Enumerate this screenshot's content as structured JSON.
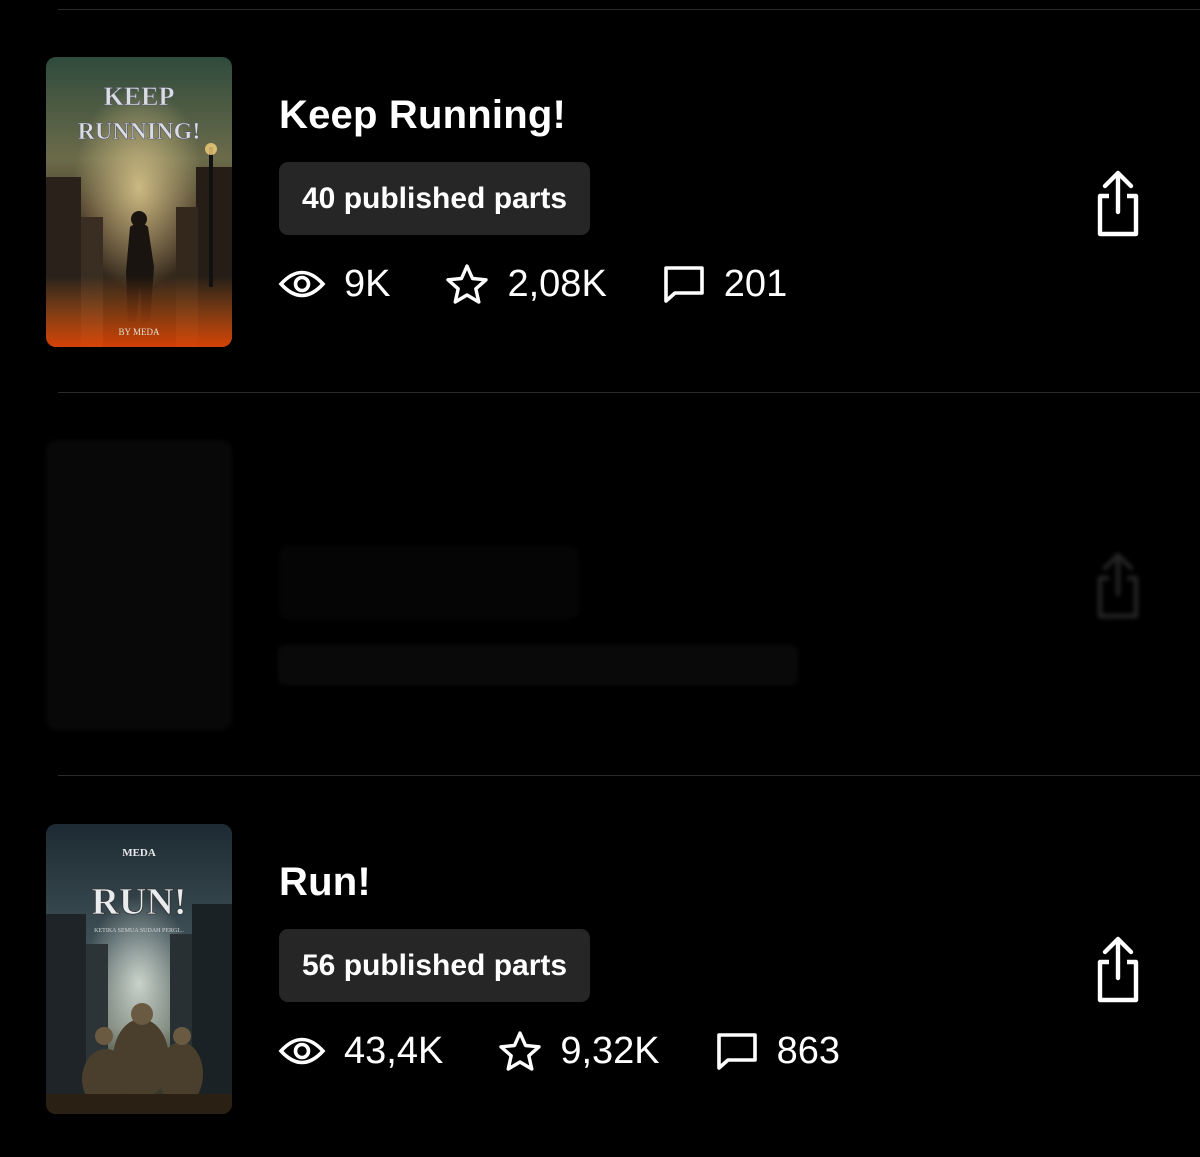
{
  "stories": [
    {
      "title": "Keep Running!",
      "parts": "40 published parts",
      "reads": "9K",
      "votes": "2,08K",
      "comments": "201",
      "cover": {
        "title_lines": [
          "KEEP",
          "RUNNING!"
        ],
        "byline": "BY MEDA"
      }
    },
    {
      "title": "",
      "parts": "",
      "reads": "",
      "votes": "",
      "comments": ""
    },
    {
      "title": "Run!",
      "parts": "56 published parts",
      "reads": "43,4K",
      "votes": "9,32K",
      "comments": "863",
      "cover": {
        "title_lines": [
          "RUN!"
        ],
        "author": "MEDA",
        "tagline": "KETIKA SEMUA SUDAH PERGI..."
      }
    }
  ],
  "icons": {
    "reads": "eye-icon",
    "votes": "star-icon",
    "comments": "comment-icon",
    "share": "share-icon"
  },
  "colors": {
    "background": "#000000",
    "badge": "#262626",
    "divider": "#2b2b2b",
    "text": "#ffffff"
  }
}
